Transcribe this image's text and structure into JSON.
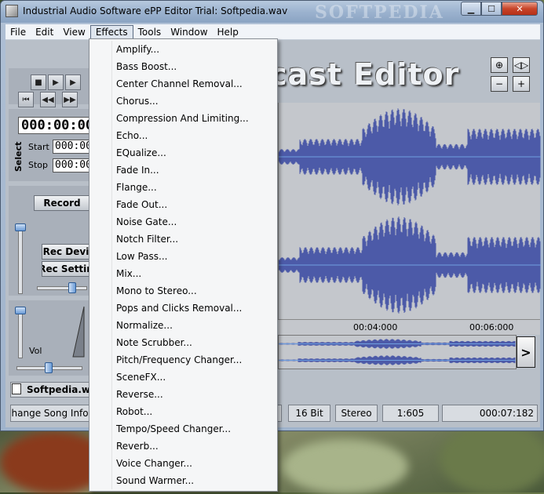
{
  "window": {
    "title": "Industrial Audio Software ePP Editor Trial: Softpedia.wav",
    "watermark": "SOFTPEDIA"
  },
  "menubar": [
    "File",
    "Edit",
    "View",
    "Effects",
    "Tools",
    "Window",
    "Help"
  ],
  "effects_menu": [
    "Amplify...",
    "Bass Boost...",
    "Center Channel Removal...",
    "Chorus...",
    "Compression And Limiting...",
    "Echo...",
    "EQualize...",
    "Fade In...",
    "Flange...",
    "Fade Out...",
    "Noise Gate...",
    "Notch Filter...",
    "Low Pass...",
    "Mix...",
    "Mono to Stereo...",
    "Pops and Clicks Removal...",
    "Normalize...",
    "Note Scrubber...",
    "Pitch/Frequency Changer...",
    "SceneFX...",
    "Reverse...",
    "Robot...",
    "Tempo/Speed Changer...",
    "Reverb...",
    "Voice Changer...",
    "Sound Warmer..."
  ],
  "left_panel": {
    "time": "000:00:00",
    "select_label": "Select",
    "start_label": "Start",
    "start_value": "000:00",
    "stop_label": "Stop",
    "stop_value": "000:00",
    "record_label": "Record",
    "rec_device_label": "Rec Devi",
    "rec_settings_label": "Rec Settin",
    "vol_label": "Vol"
  },
  "banner": "cast Editor",
  "timeline": {
    "tick1": "00:04:000",
    "tick2": "00:06:000"
  },
  "overview_arrow": ">",
  "file": {
    "name": "Softpedia.wa"
  },
  "status": {
    "song_info": "Change Song Info...",
    "bits": "16 Bit",
    "channels": "Stereo",
    "ratio": "1:605",
    "length": "000:07:182"
  },
  "colors": {
    "waveform": "#4c5aa8",
    "center_line": "#6fa0e0"
  }
}
